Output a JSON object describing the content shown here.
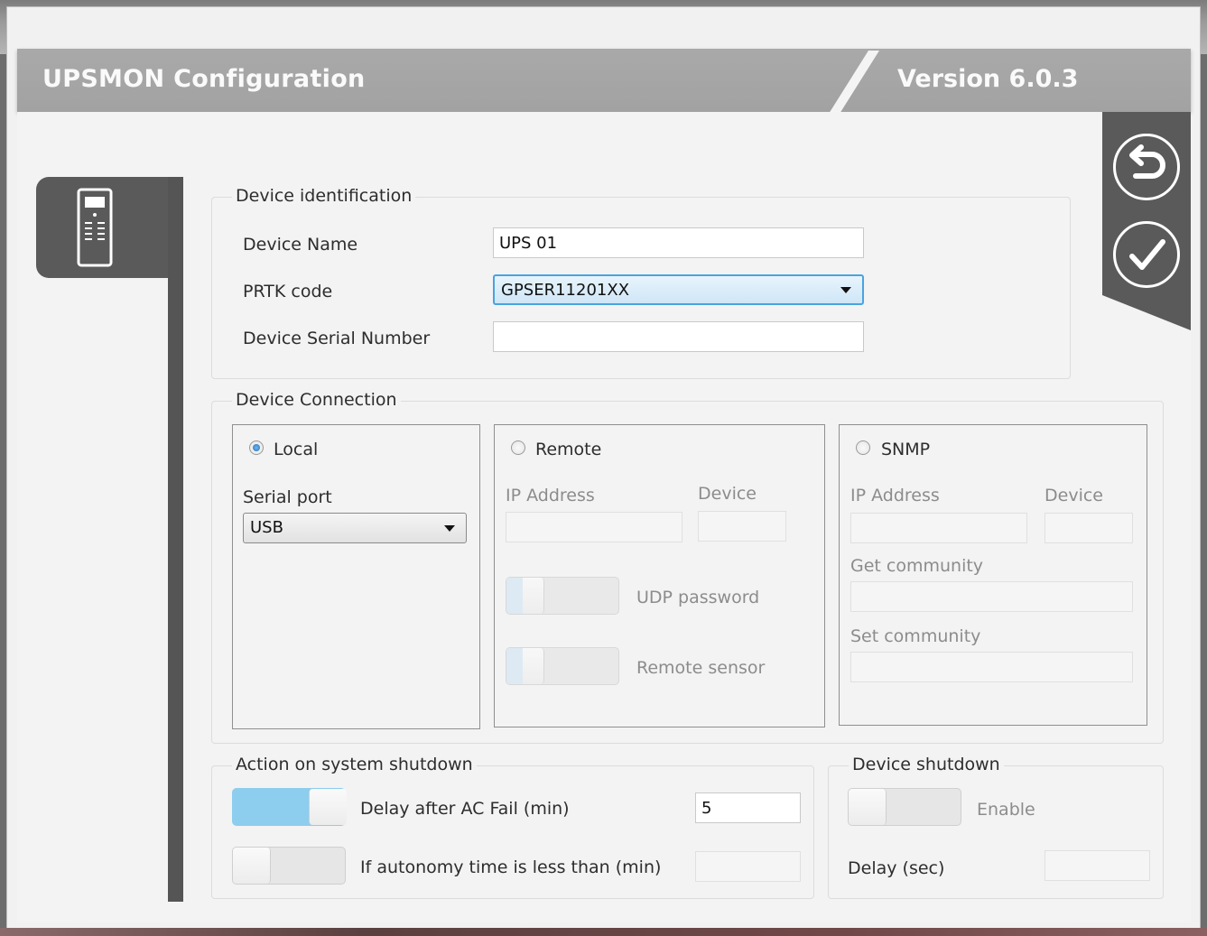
{
  "header": {
    "title": "UPSMON Configuration",
    "version": "Version 6.0.3"
  },
  "nav": {
    "device_tab_icon": "device-remote-icon"
  },
  "actions": {
    "back_icon": "undo-arrow-icon",
    "confirm_icon": "checkmark-icon"
  },
  "device_identification": {
    "legend": "Device identification",
    "device_name_label": "Device Name",
    "device_name_value": "UPS 01",
    "prtk_label": "PRTK code",
    "prtk_value": "GPSER11201XX",
    "serial_label": "Device Serial Number",
    "serial_value": ""
  },
  "device_connection": {
    "legend": "Device Connection",
    "local": {
      "label": "Local",
      "selected": true,
      "serial_port_label": "Serial port",
      "serial_port_value": "USB"
    },
    "remote": {
      "label": "Remote",
      "selected": false,
      "ip_label": "IP Address",
      "device_label": "Device",
      "udp_password_label": "UDP password",
      "remote_sensor_label": "Remote sensor"
    },
    "snmp": {
      "label": "SNMP",
      "selected": false,
      "ip_label": "IP Address",
      "device_label": "Device",
      "get_community_label": "Get community",
      "set_community_label": "Set community"
    }
  },
  "system_shutdown": {
    "legend": "Action on system shutdown",
    "delay_label": "Delay after AC Fail (min)",
    "delay_enabled": true,
    "delay_value": "5",
    "autonomy_label": "If autonomy time is less than (min)",
    "autonomy_enabled": false,
    "autonomy_value": ""
  },
  "device_shutdown": {
    "legend": "Device shutdown",
    "enable_label": "Enable",
    "enabled": false,
    "delay_label": "Delay (sec)",
    "delay_value": ""
  }
}
